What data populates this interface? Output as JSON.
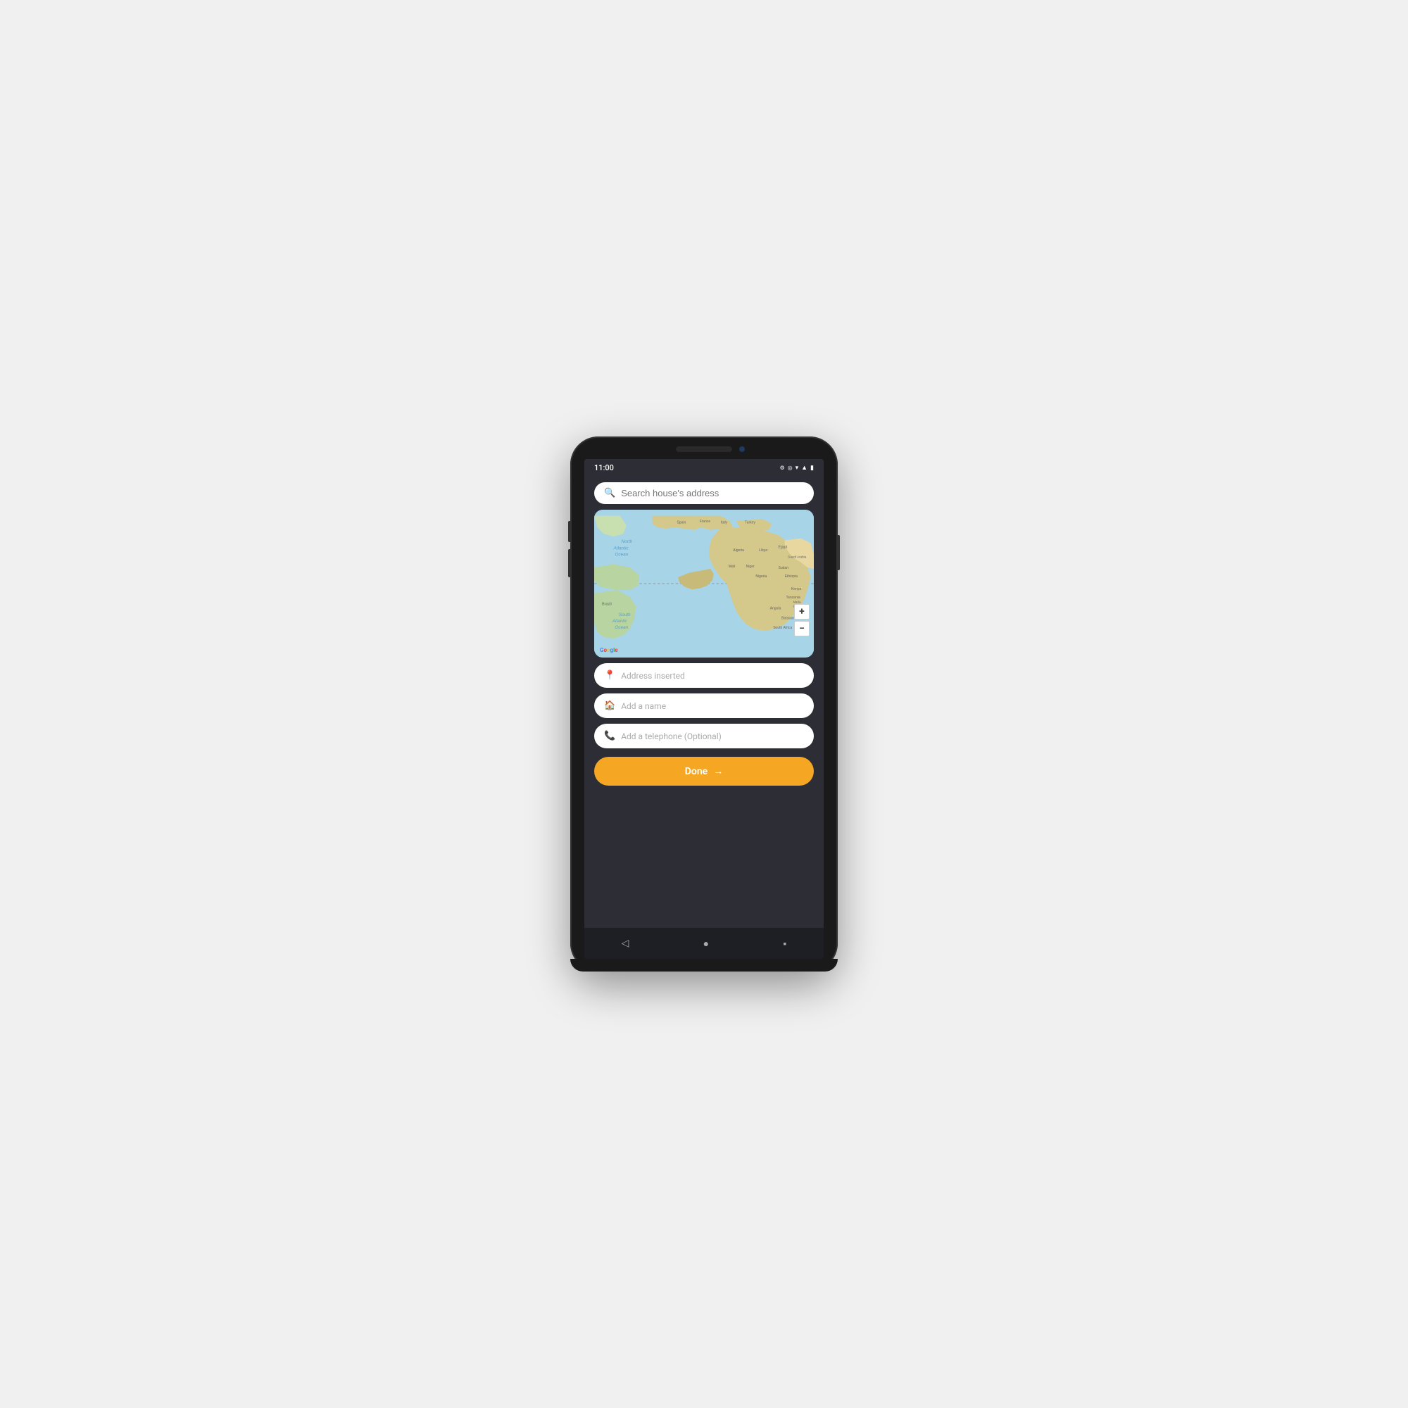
{
  "status_bar": {
    "time": "11:00",
    "icons": [
      "⚙",
      "◎",
      "▼",
      "▲",
      "▮"
    ]
  },
  "search": {
    "placeholder": "Search house's address"
  },
  "map": {
    "ocean_label_north": "North\nAtlantic\nOcean",
    "ocean_label_south": "South\nAtlantic\nOcean",
    "zoom_in": "+",
    "zoom_out": "−",
    "google_label": "Google"
  },
  "form": {
    "address_placeholder": "Address inserted",
    "name_placeholder": "Add a name",
    "phone_placeholder": "Add a telephone (Optional)"
  },
  "done_button": {
    "label": "Done",
    "arrow": "→"
  },
  "nav": {
    "back": "◁",
    "home": "●",
    "recent": "▪"
  }
}
